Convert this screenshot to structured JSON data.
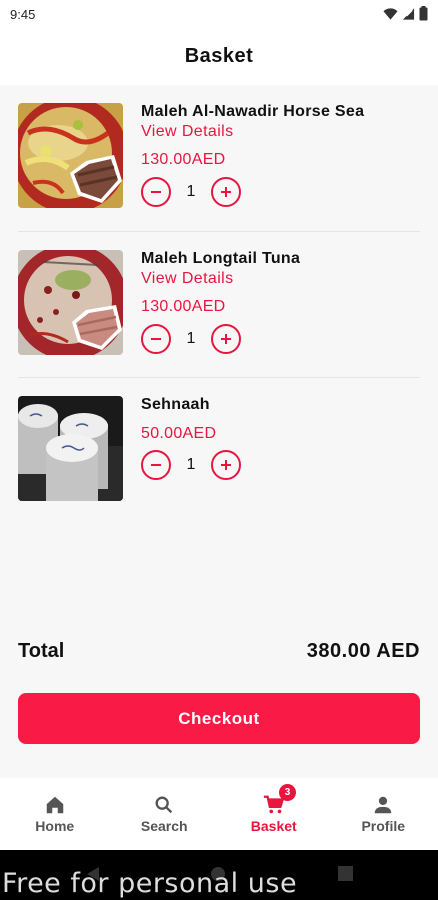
{
  "status_bar": {
    "time": "9:45"
  },
  "header": {
    "title": "Basket"
  },
  "items": [
    {
      "name": "Maleh Al-Nawadir Horse Sea",
      "link": "View Details",
      "price": "130.00AED",
      "qty": "1"
    },
    {
      "name": "Maleh Longtail Tuna",
      "link": "View Details",
      "price": "130.00AED",
      "qty": "1"
    },
    {
      "name": "Sehnaah",
      "price": "50.00AED",
      "qty": "1"
    }
  ],
  "summary": {
    "total_label": "Total",
    "total_value": "380.00 AED"
  },
  "checkout_label": "Checkout",
  "nav": {
    "items": [
      {
        "label": "Home",
        "icon": "home-icon"
      },
      {
        "label": "Search",
        "icon": "search-icon"
      },
      {
        "label": "Basket",
        "icon": "cart-icon",
        "badge": "3"
      },
      {
        "label": "Profile",
        "icon": "person-icon"
      }
    ],
    "active": "Basket"
  },
  "watermark": "Free for personal use",
  "colors": {
    "accent": "#e8163f",
    "button": "#f91a45"
  }
}
